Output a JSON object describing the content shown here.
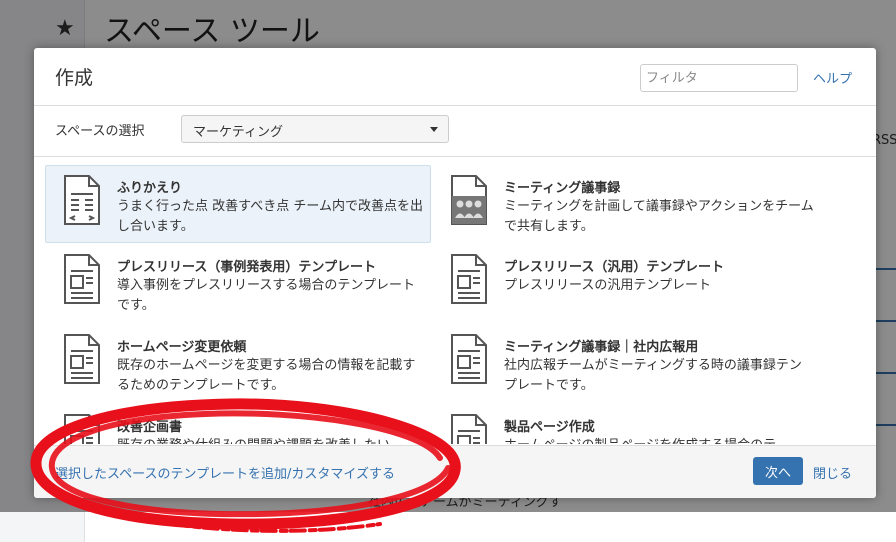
{
  "background": {
    "page_title": "スペース ツール",
    "rss_text": "RSS",
    "bottom_text": "社内広報チームがミーティングす"
  },
  "dialog": {
    "title": "作成",
    "filter_placeholder": "フィルタ",
    "help_label": "ヘルプ",
    "space_label": "スペースの選択",
    "space_selected": "マーケティング",
    "templates": [
      {
        "name": "ふりかえり",
        "desc": "うまく行った点 改善すべき点 チーム内で改善点を出し合います。",
        "icon": "retrospective-icon",
        "selected": true
      },
      {
        "name": "ミーティング議事録",
        "desc": "ミーティングを計画して議事録やアクションをチームで共有します。",
        "icon": "meeting-notes-icon",
        "selected": false
      },
      {
        "name": "プレスリリース（事例発表用）テンプレート",
        "desc": "導入事例をプレスリリースする場合のテンプレートです。",
        "icon": "document-icon",
        "selected": false
      },
      {
        "name": "プレスリリース（汎用）テンプレート",
        "desc": "プレスリリースの汎用テンプレート",
        "icon": "document-icon",
        "selected": false
      },
      {
        "name": "ホームページ変更依頼",
        "desc": "既存のホームページを変更する場合の情報を記載するためのテンプレートです。",
        "icon": "document-icon",
        "selected": false
      },
      {
        "name": "ミーティング議事録｜社内広報用",
        "desc": "社内広報チームがミーティングする時の議事録テンプレートです。",
        "icon": "document-icon",
        "selected": false
      },
      {
        "name": "改善企画書",
        "desc": "既存の業務や仕組みの問題や課題を改善したい",
        "icon": "document-icon",
        "selected": false
      },
      {
        "name": "製品ページ作成",
        "desc": "ホームページの製品ページを作成する場合のテ",
        "icon": "document-icon",
        "selected": false
      }
    ],
    "customize_link": "選択したスペースのテンプレートを追加/カスタマイズする",
    "next_label": "次へ",
    "close_label": "閉じる"
  },
  "colors": {
    "link": "#3572b0",
    "primary_button": "#3572b0",
    "highlight_annotation": "#e8101a",
    "selected_bg": "#ebf2f9"
  }
}
